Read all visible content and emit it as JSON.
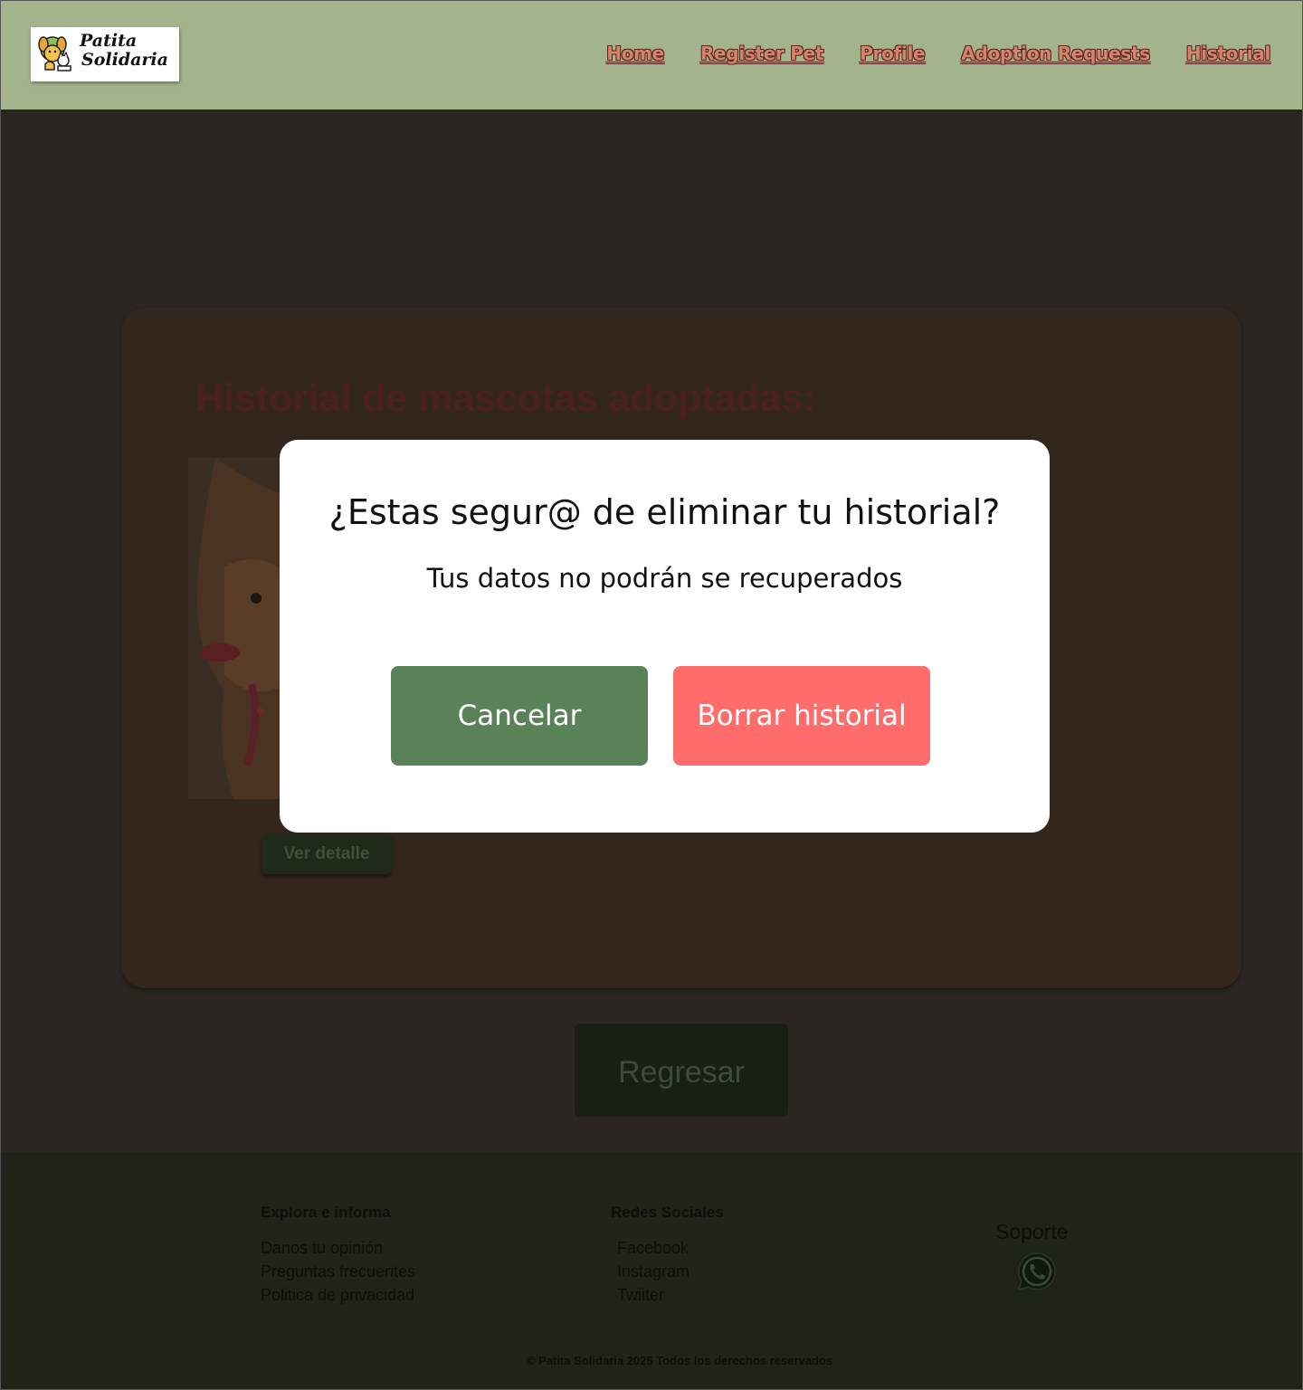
{
  "header": {
    "logo": {
      "line1": "Patita",
      "line2": "Solidaria"
    },
    "nav": [
      {
        "label": "Home"
      },
      {
        "label": "Register Pet"
      },
      {
        "label": "Profile"
      },
      {
        "label": "Adoption Requests"
      },
      {
        "label": "Historial"
      }
    ]
  },
  "main": {
    "title": "Historial de mascotas adoptadas:",
    "detail_button": "Ver detalle",
    "back_button": "Regresar"
  },
  "modal": {
    "title": "¿Estas segur@ de eliminar tu historial?",
    "message": "Tus datos no podrán se recuperados",
    "cancel_label": "Cancelar",
    "confirm_label": "Borrar historial"
  },
  "footer": {
    "explore": {
      "heading": "Explora e informa",
      "links": [
        "Danos tu opinión",
        "Preguntas frecuentes",
        "Politica de privacidad"
      ]
    },
    "social": {
      "heading": "Redes Sociales",
      "links": [
        "Facebook",
        "Instagram",
        "Twiiter"
      ]
    },
    "support": {
      "heading": "Soporte",
      "icon": "whatsapp-icon"
    },
    "copyright": "© Patita Solidaria 2025 Todos los derechos reservados"
  },
  "colors": {
    "header_bg": "#a3b48d",
    "nav_text": "#d7826c",
    "cancel_button": "#5a8259",
    "delete_button": "#fe6d6c",
    "overlay_tint": "#2b2621"
  }
}
